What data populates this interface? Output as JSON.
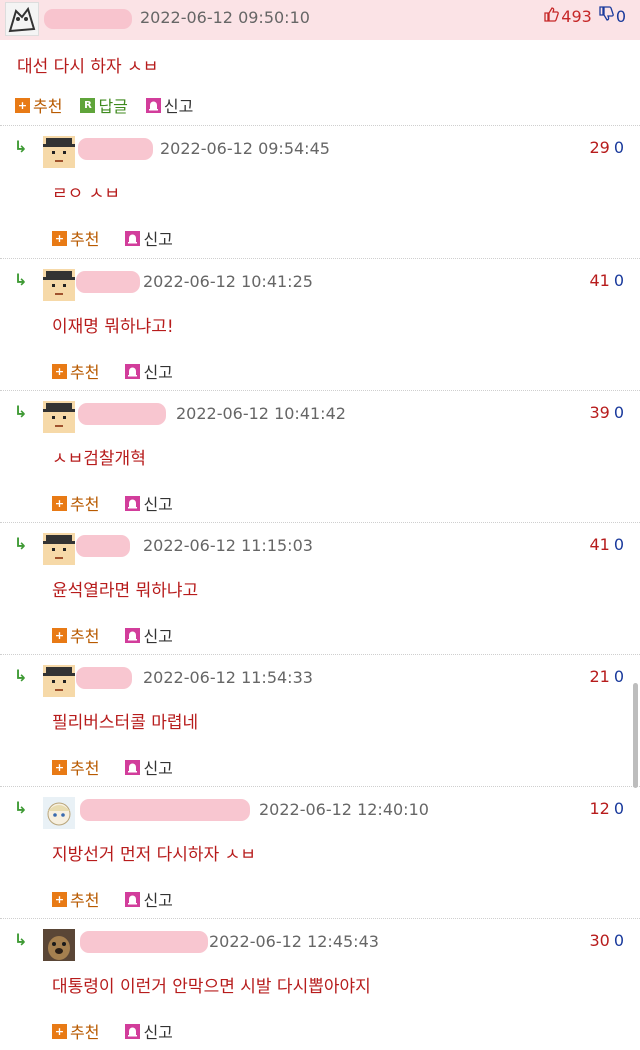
{
  "post": {
    "timestamp": "2022-06-12 09:50:10",
    "upvotes": "493",
    "downvotes": "0",
    "body": "대선 다시 하자 ㅅㅂ",
    "actions": {
      "recommend": "추천",
      "reply": "답글",
      "report": "신고"
    }
  },
  "comments": [
    {
      "timestamp": "2022-06-12 09:54:45",
      "upvotes": "29",
      "downvotes": "0",
      "body": "ㄹㅇ ㅅㅂ",
      "recommend": "추천",
      "report": "신고"
    },
    {
      "timestamp": "2022-06-12 10:41:25",
      "upvotes": "41",
      "downvotes": "0",
      "body": "이재명 뭐하냐고!",
      "recommend": "추천",
      "report": "신고"
    },
    {
      "timestamp": "2022-06-12 10:41:42",
      "upvotes": "39",
      "downvotes": "0",
      "body": "ㅅㅂ검찰개혁",
      "recommend": "추천",
      "report": "신고"
    },
    {
      "timestamp": "2022-06-12 11:15:03",
      "upvotes": "41",
      "downvotes": "0",
      "body": "윤석열라면 뭐하냐고",
      "recommend": "추천",
      "report": "신고"
    },
    {
      "timestamp": "2022-06-12 11:54:33",
      "upvotes": "21",
      "downvotes": "0",
      "body": "필리버스터콜 마렵네",
      "recommend": "추천",
      "report": "신고"
    },
    {
      "timestamp": "2022-06-12 12:40:10",
      "upvotes": "12",
      "downvotes": "0",
      "body": "지방선거 먼저 다시하자 ㅅㅂ",
      "recommend": "추천",
      "report": "신고"
    },
    {
      "timestamp": "2022-06-12 12:45:43",
      "upvotes": "30",
      "downvotes": "0",
      "body": "대통령이 이런거 안막으면 시발 다시뽑아야지",
      "recommend": "추천",
      "report": "신고"
    }
  ],
  "icons": {
    "reply_arrow": "reply-arrow-icon",
    "thumb_up": "thumbs-up-icon",
    "thumb_down": "thumbs-down-icon"
  }
}
